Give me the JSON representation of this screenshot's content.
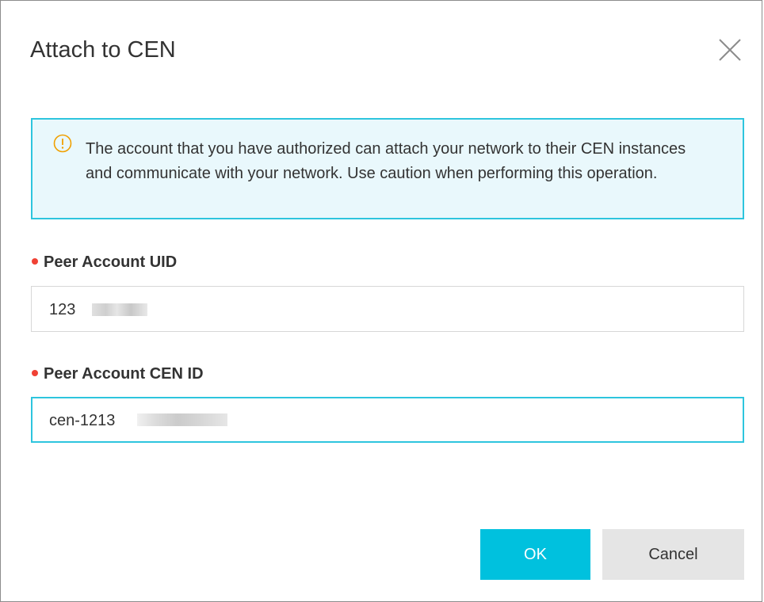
{
  "dialog": {
    "title": "Attach to CEN",
    "close_icon": "close-icon"
  },
  "notice": {
    "icon": "info-circle-icon",
    "text": "The account that you have authorized can attach your network to their CEN instances and communicate with your network. Use caution when performing this operation.",
    "accent_color": "#2ec5de",
    "background_color": "#e9f8fc"
  },
  "form": {
    "peer_uid": {
      "label": "Peer Account UID",
      "value": "123"
    },
    "peer_cen_id": {
      "label": "Peer Account CEN ID",
      "value": "cen-1213"
    },
    "required_color": "#f04134"
  },
  "footer": {
    "ok_label": "OK",
    "cancel_label": "Cancel",
    "primary_color": "#00c1de"
  }
}
